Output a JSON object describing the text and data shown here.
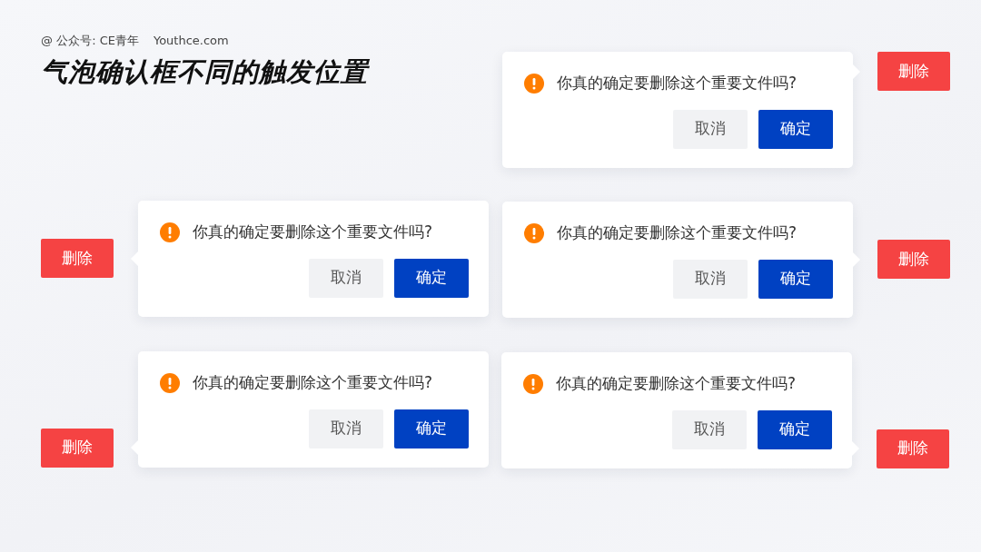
{
  "header": {
    "source": "@ 公众号: CE青年",
    "site": "Youthce.com"
  },
  "title": "气泡确认框不同的触发位置",
  "demos": [
    {
      "kind": "left-start",
      "trigger": "删除",
      "message": "你真的确定要删除这个重要文件吗?",
      "cancel": "取消",
      "confirm": "确定"
    },
    {
      "kind": "right",
      "trigger": "删除",
      "message": "你真的确定要删除这个重要文件吗?",
      "cancel": "取消",
      "confirm": "确定"
    },
    {
      "kind": "left",
      "trigger": "删除",
      "message": "你真的确定要删除这个重要文件吗?",
      "cancel": "取消",
      "confirm": "确定"
    },
    {
      "kind": "right-end",
      "trigger": "删除",
      "message": "你真的确定要删除这个重要文件吗?",
      "cancel": "取消",
      "confirm": "确定"
    },
    {
      "kind": "left-end",
      "trigger": "删除",
      "message": "你真的确定要删除这个重要文件吗?",
      "cancel": "取消",
      "confirm": "确定"
    }
  ]
}
